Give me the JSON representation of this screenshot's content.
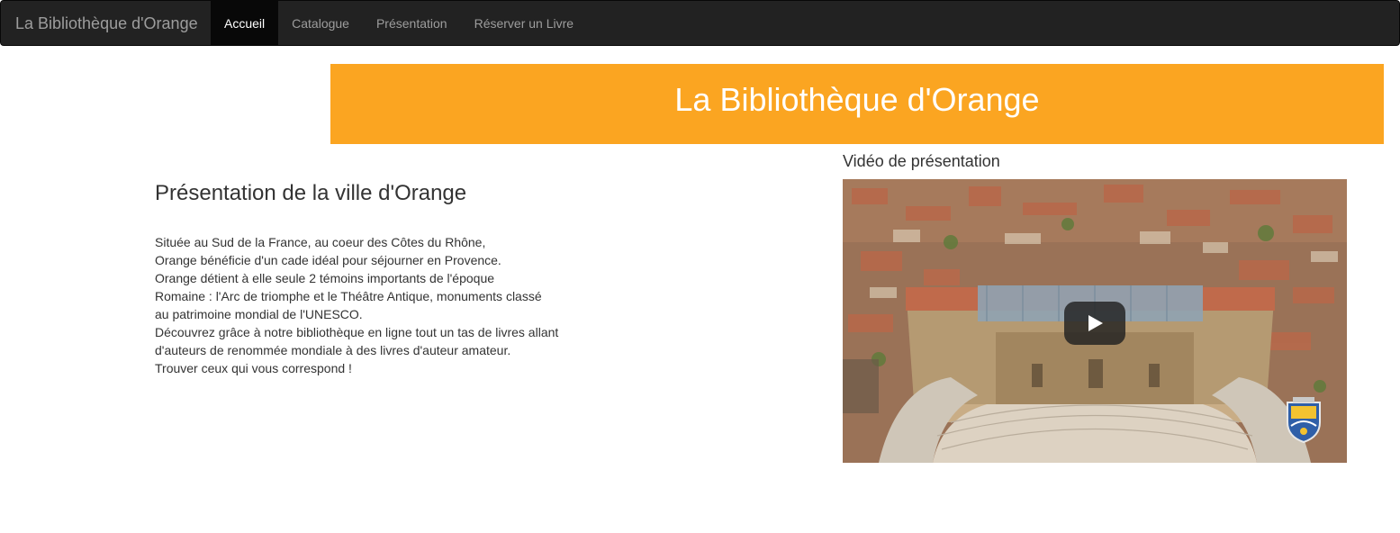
{
  "navbar": {
    "brand": "La Bibliothèque d'Orange",
    "items": [
      {
        "label": "Accueil",
        "active": true
      },
      {
        "label": "Catalogue",
        "active": false
      },
      {
        "label": "Présentation",
        "active": false
      },
      {
        "label": "Réserver un Livre",
        "active": false
      }
    ]
  },
  "banner": {
    "title": "La Bibliothèque d'Orange",
    "color": "#fba521"
  },
  "main": {
    "section_title": "Présentation de la ville d'Orange",
    "paragraph_lines": [
      "Située au Sud de la France, au coeur des Côtes du Rhône,",
      "Orange bénéficie d'un cade idéal pour séjourner en Provence.",
      "Orange détient à elle seule 2 témoins importants de l'époque",
      "Romaine : l'Arc de triomphe et le Théâtre Antique, monuments classé",
      "au patrimoine mondial de l'UNESCO.",
      "Découvrez grâce à notre bibliothèque en ligne tout un tas de livres allant",
      "d'auteurs de renommée mondiale à des livres d'auteur amateur.",
      "Trouver ceux qui vous correspond !"
    ]
  },
  "video": {
    "title": "Vidéo de présentation",
    "play_icon": "play-icon",
    "overlay_icon": "city-crest-icon"
  }
}
